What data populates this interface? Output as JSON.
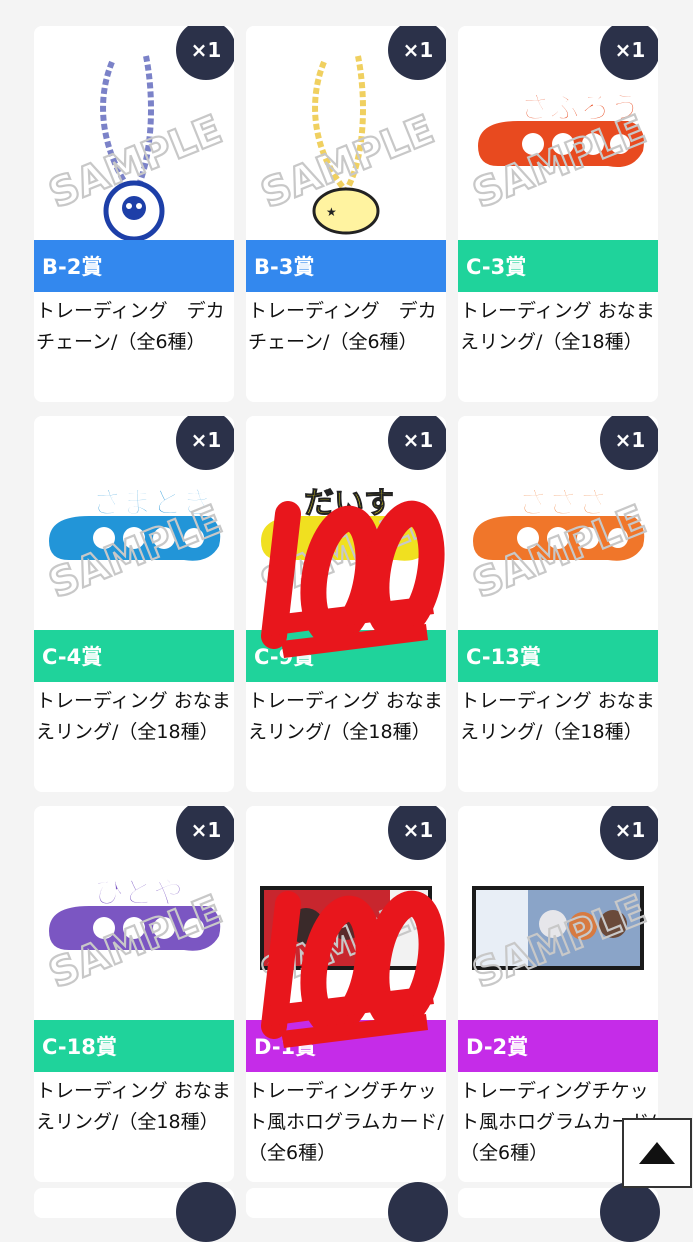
{
  "qty_label": "×1",
  "sample_text": "SAMPLE",
  "colors": {
    "blue": "#3388ee",
    "green": "#1fd39b",
    "purple": "#c52ce8",
    "badge": "#2b3149"
  },
  "cards": [
    {
      "prize": "B-2賞",
      "name": "トレーディング　デカチェーン/（全6種）",
      "tag_color": "blue",
      "image": "chain-charm-blue-skull"
    },
    {
      "prize": "B-3賞",
      "name": "トレーディング　デカチェーン/（全6種）",
      "tag_color": "blue",
      "image": "chain-charm-yellow"
    },
    {
      "prize": "C-3賞",
      "name": "トレーディング おなまえリング/（全18種）",
      "tag_color": "green",
      "image": "name-ring-red",
      "ring_text": "さぶろう"
    },
    {
      "prize": "C-4賞",
      "name": "トレーディング おなまえリング/（全18種）",
      "tag_color": "green",
      "image": "name-ring-blue",
      "ring_text": "さまとき"
    },
    {
      "prize": "C-9賞",
      "name": "トレーディング おなまえリング/（全18種）",
      "tag_color": "green",
      "image": "name-ring-yellow",
      "ring_text": "だいす",
      "emoji_overlay": "hundred-points-emoji"
    },
    {
      "prize": "C-13賞",
      "name": "トレーディング おなまえリング/（全18種）",
      "tag_color": "green",
      "image": "name-ring-orange",
      "ring_text": "さささ"
    },
    {
      "prize": "C-18賞",
      "name": "トレーディング おなまえリング/（全18種）",
      "tag_color": "green",
      "image": "name-ring-purple",
      "ring_text": "ひとや"
    },
    {
      "prize": "D-1賞",
      "name": "トレーディングチケット風ホログラムカード/（全6種）",
      "tag_color": "purple",
      "image": "hologram-card-red",
      "emoji_overlay": "hundred-points-emoji"
    },
    {
      "prize": "D-2賞",
      "name": "トレーディングチケット風ホログラムカード/（全6種）",
      "tag_color": "purple",
      "image": "hologram-card-blue"
    }
  ]
}
